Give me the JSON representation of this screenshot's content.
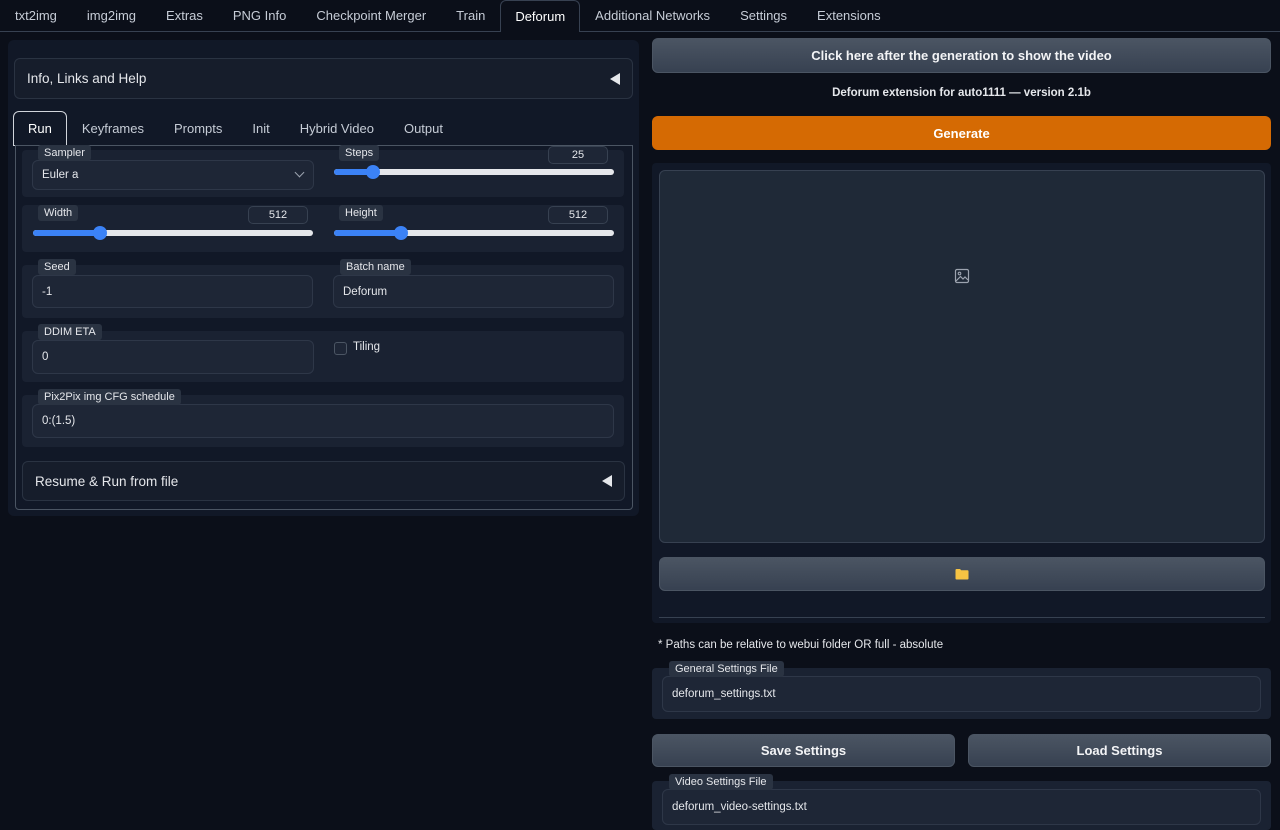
{
  "top_tabs": [
    "txt2img",
    "img2img",
    "Extras",
    "PNG Info",
    "Checkpoint Merger",
    "Train",
    "Deforum",
    "Additional Networks",
    "Settings",
    "Extensions"
  ],
  "active_top_tab": "Deforum",
  "info_accordion": "Info, Links and Help",
  "sub_tabs": [
    "Run",
    "Keyframes",
    "Prompts",
    "Init",
    "Hybrid Video",
    "Output"
  ],
  "active_sub_tab": "Run",
  "run": {
    "sampler": {
      "label": "Sampler",
      "value": "Euler a"
    },
    "steps": {
      "label": "Steps",
      "value": "25",
      "fraction": 0.14
    },
    "width": {
      "label": "Width",
      "value": "512",
      "fraction": 0.24
    },
    "height": {
      "label": "Height",
      "value": "512",
      "fraction": 0.24
    },
    "seed": {
      "label": "Seed",
      "value": "-1"
    },
    "batch_name": {
      "label": "Batch name",
      "value": "Deforum"
    },
    "ddim_eta": {
      "label": "DDIM ETA",
      "value": "0"
    },
    "tiling": {
      "label": "Tiling",
      "checked": false
    },
    "pix2pix": {
      "label": "Pix2Pix img CFG schedule",
      "value": "0:(1.5)"
    },
    "resume_accordion": "Resume & Run from file"
  },
  "right": {
    "show_video_button": "Click here after the generation to show the video",
    "version_text": "Deforum extension for auto1111 — version 2.1b",
    "generate_button": "Generate",
    "paths_note": "* Paths can be relative to webui folder OR full - absolute",
    "general_settings": {
      "label": "General Settings File",
      "value": "deforum_settings.txt"
    },
    "save_button": "Save Settings",
    "load_button": "Load Settings",
    "video_settings": {
      "label": "Video Settings File",
      "value": "deforum_video-settings.txt"
    }
  },
  "colors": {
    "accent": "#3b82f6",
    "generate": "#d56a03",
    "folder": "#f6c343"
  }
}
